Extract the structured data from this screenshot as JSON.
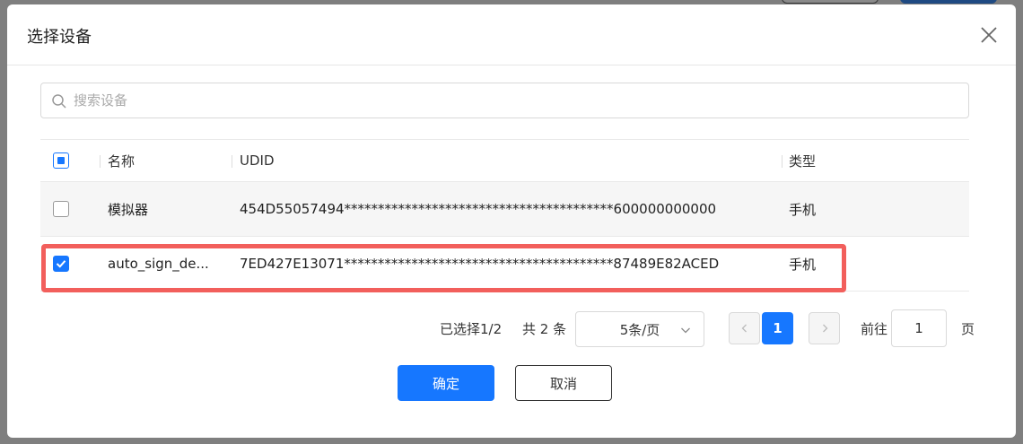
{
  "dialog": {
    "title": "选择设备"
  },
  "search": {
    "placeholder": "搜索设备",
    "value": ""
  },
  "table": {
    "columns": [
      "名称",
      "UDID",
      "类型"
    ],
    "header_checkbox_state": "indeterminate",
    "rows": [
      {
        "name": "模拟器",
        "udid": "454D55057494****************************************600000000000",
        "type": "手机",
        "checked": false
      },
      {
        "name": "auto_sign_de...",
        "udid": "7ED427E13071****************************************87489E82ACED",
        "type": "手机",
        "checked": true
      }
    ]
  },
  "pagination": {
    "selected_text": "已选择1/2",
    "total_text": "共 2 条",
    "page_size": "5条/页",
    "current_page": "1",
    "goto_label": "前往",
    "goto_value": "1",
    "goto_suffix": "页"
  },
  "footer": {
    "ok_label": "确定",
    "cancel_label": "取消"
  },
  "colors": {
    "accent": "#1677ff",
    "highlight": "#f25f5c"
  }
}
